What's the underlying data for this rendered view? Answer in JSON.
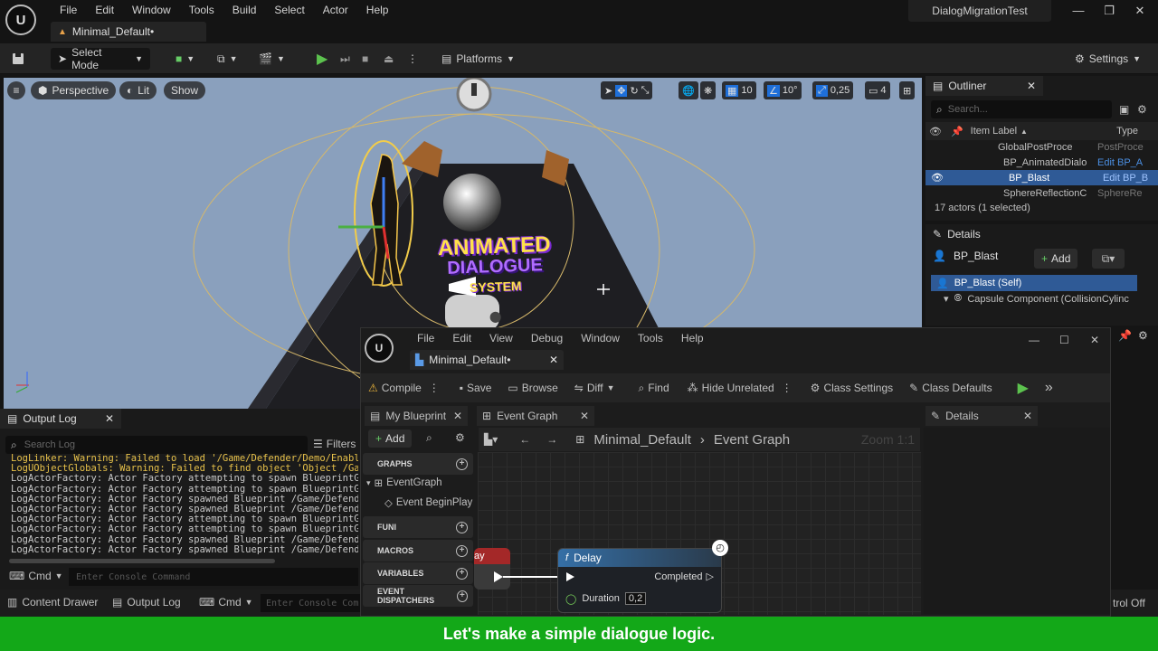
{
  "app": {
    "menu": [
      "File",
      "Edit",
      "Window",
      "Tools",
      "Build",
      "Select",
      "Actor",
      "Help"
    ],
    "doc_tab": "Minimal_Default•",
    "project": "DialogMigrationTest"
  },
  "toolbar": {
    "select_mode": "Select Mode",
    "platforms": "Platforms",
    "settings": "Settings"
  },
  "viewport": {
    "perspective": "Perspective",
    "lit": "Lit",
    "show": "Show",
    "grid": "10",
    "angle": "10°",
    "scale": "0,25",
    "cam_speed": "4",
    "logo_line1": "ANIMATED",
    "logo_line2": "DIALOGUE",
    "logo_line3": "SYSTEM"
  },
  "outliner": {
    "title": "Outliner",
    "search_placeholder": "Search...",
    "col_label": "Item Label",
    "col_type": "Type",
    "rows": [
      {
        "label": "GlobalPostProce",
        "type": "PostProce"
      },
      {
        "label": "BP_AnimatedDialo",
        "type": "Edit BP_A"
      },
      {
        "label": "BP_Blast",
        "type": "Edit BP_B"
      },
      {
        "label": "SphereReflectionC",
        "type": "SphereRe"
      }
    ],
    "count": "17 actors (1 selected)"
  },
  "details": {
    "title": "Details",
    "actor": "BP_Blast",
    "add": "Add",
    "self": "BP_Blast (Self)",
    "capsule": "Capsule Component (CollisionCylinc"
  },
  "output_log": {
    "title": "Output Log",
    "search_placeholder": "Search Log",
    "filters": "Filters",
    "lines": [
      "LogLinker: Warning: Failed to load '/Game/Defender/Demo/Enableme",
      "LogUObjectGlobals: Warning: Failed to find object 'Object /Game/",
      "LogActorFactory: Actor Factory attempting to spawn BlueprintGene",
      "LogActorFactory: Actor Factory attempting to spawn BlueprintGene",
      "LogActorFactory: Actor Factory spawned Blueprint /Game/Defender/",
      "LogActorFactory: Actor Factory spawned Blueprint /Game/Defender/",
      "LogActorFactory: Actor Factory attempting to spawn BlueprintGene",
      "LogActorFactory: Actor Factory attempting to spawn BlueprintGene",
      "LogActorFactory: Actor Factory spawned Blueprint /Game/Defender/",
      "LogActorFactory: Actor Factory spawned Blueprint /Game/Defender/"
    ],
    "cmd": "Cmd",
    "console_placeholder": "Enter Console Command"
  },
  "statusbar": {
    "content_drawer": "Content Drawer",
    "output_log": "Output Log",
    "cmd": "Cmd",
    "console_placeholder": "Enter Console Com",
    "right": "trol Off"
  },
  "bp": {
    "menu": [
      "File",
      "Edit",
      "View",
      "Debug",
      "Window",
      "Tools",
      "Help"
    ],
    "tab": "Minimal_Default•",
    "toolbar": {
      "compile": "Compile",
      "save": "Save",
      "browse": "Browse",
      "diff": "Diff",
      "find": "Find",
      "hide_unrelated": "Hide Unrelated",
      "class_settings": "Class Settings",
      "class_defaults": "Class Defaults"
    },
    "my_blueprint": "My Blueprint",
    "event_graph_tab": "Event Graph",
    "details": "Details",
    "add": "Add",
    "sections": {
      "graphs": "GRAPHS",
      "event_graph": "EventGraph",
      "begin_play": "Event BeginPlay",
      "functions": "FUNI",
      "macros": "MACROS",
      "variables": "VARIABLES",
      "dispatchers": "EVENT DISPATCHERS"
    },
    "breadcrumb_root": "Minimal_Default",
    "breadcrumb_leaf": "Event Graph",
    "zoom": "Zoom 1:1",
    "node": {
      "title": "Delay",
      "completed": "Completed",
      "duration_label": "Duration",
      "duration_value": "0,2",
      "prev_node_fragment": "ay"
    }
  },
  "caption": "Let's make a simple dialogue logic."
}
